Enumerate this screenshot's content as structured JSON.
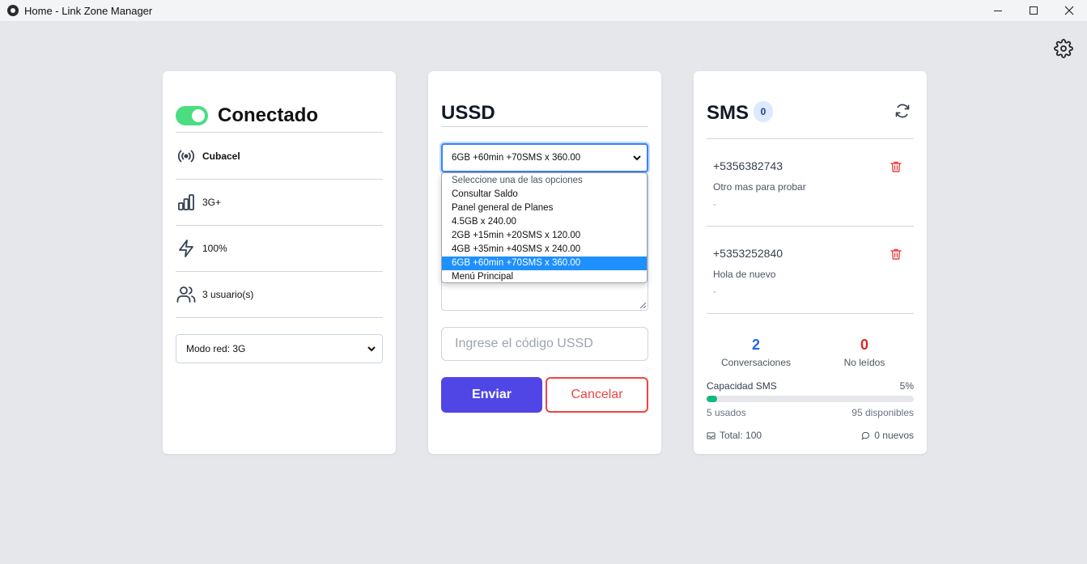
{
  "window": {
    "title": "Home - Link Zone Manager",
    "icon": "app-logo-icon"
  },
  "status": {
    "title": "Conectado",
    "connected": true,
    "operator": "Cubacel",
    "network_type": "3G+",
    "battery": "100%",
    "users": "3 usuario(s)",
    "network_mode": "Modo red: 3G"
  },
  "ussd": {
    "title": "USSD",
    "selected": "6GB +60min +70SMS x 360.00",
    "options": [
      "Seleccione una de las opciones",
      "Consultar Saldo",
      "Panel general de Planes",
      "4.5GB x 240.00",
      "2GB +15min +20SMS x 120.00",
      "4GB +35min +40SMS x 240.00",
      "6GB +60min +70SMS x 360.00",
      "Menú Principal"
    ],
    "input_placeholder": "Ingrese el código USSD",
    "send_label": "Enviar",
    "cancel_label": "Cancelar"
  },
  "sms": {
    "title": "SMS",
    "badge": "0",
    "messages": [
      {
        "number": "+5356382743",
        "text": "Otro mas para probar",
        "date": "-"
      },
      {
        "number": "+5353252840",
        "text": "Hola de nuevo",
        "date": "-"
      }
    ],
    "conversations_value": "2",
    "conversations_label": "Conversaciones",
    "unread_value": "0",
    "unread_label": "No leídos",
    "capacity_label": "Capacidad SMS",
    "capacity_pct": "5%",
    "capacity_fraction": 0.05,
    "used": "5 usados",
    "available": "95 disponibles",
    "total": "Total: 100",
    "new": "0 nuevos"
  },
  "colors": {
    "toggle_on": "#4ade80",
    "primary": "#4f46e5",
    "danger": "#ef4444",
    "progress": "#10b981",
    "selected_option": "#1e90ff"
  }
}
